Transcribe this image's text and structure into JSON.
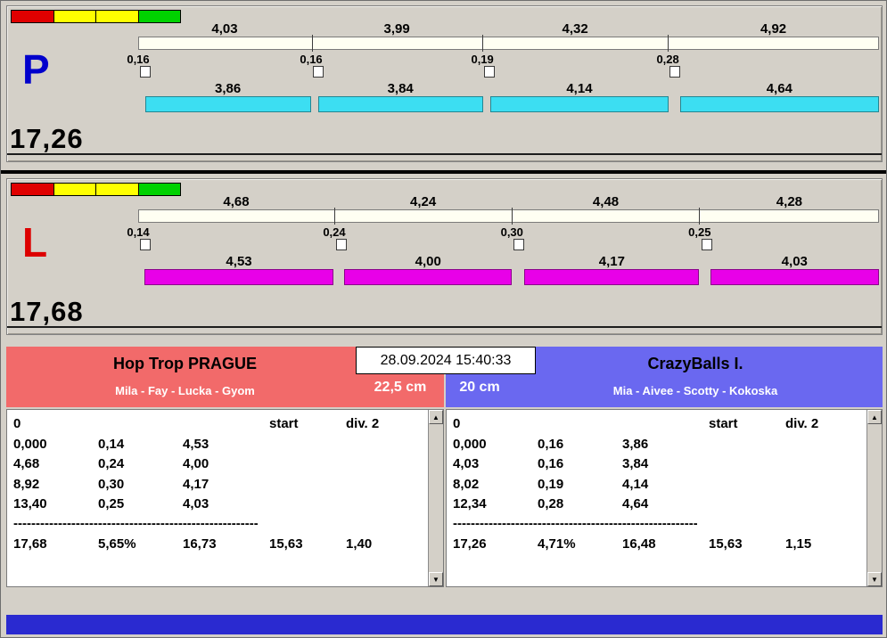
{
  "window": {
    "bg_color": "#d4d0c8",
    "bottom_strip_color": "#2a2ad0"
  },
  "status_lights": {
    "colors": [
      "#e00000",
      "#ffff00",
      "#ffff00",
      "#00d200"
    ]
  },
  "lanes": [
    {
      "label": "P",
      "label_color": "#0000cc",
      "total": "17,26",
      "run_bar_color": "#3cdef2",
      "splits_top": [
        "4,03",
        "3,99",
        "4,32",
        "4,92"
      ],
      "reactions": [
        "0,16",
        "0,16",
        "0,19",
        "0,28"
      ],
      "runs": [
        "3,86",
        "3,84",
        "4,14",
        "4,64"
      ]
    },
    {
      "label": "L",
      "label_color": "#dd0000",
      "total": "17,68",
      "run_bar_color": "#e800e8",
      "splits_top": [
        "4,68",
        "4,24",
        "4,48",
        "4,28"
      ],
      "reactions": [
        "0,14",
        "0,24",
        "0,30",
        "0,25"
      ],
      "runs": [
        "4,53",
        "4,00",
        "4,17",
        "4,03"
      ]
    }
  ],
  "scoreboard": {
    "datetime": "28.09.2024 15:40:33",
    "left_team": {
      "name": "Hop Trop PRAGUE",
      "members": "Mila - Fay - Lucka - Gyom",
      "jump_height": "22,5 cm",
      "header_color": "#f26a6a"
    },
    "right_team": {
      "name": "CrazyBalls I.",
      "members": "Mia - Aivee - Scotty - Kokoska",
      "jump_height": "20 cm",
      "header_color": "#6a68f0"
    }
  },
  "tables": {
    "left": {
      "lap_counter": "0",
      "start_label": "start",
      "division_label": "div. 2",
      "rows": [
        [
          "0,000",
          "0,14",
          "4,53"
        ],
        [
          "4,68",
          "0,24",
          "4,00"
        ],
        [
          "8,92",
          "0,30",
          "4,17"
        ],
        [
          "13,40",
          "0,25",
          "4,03"
        ]
      ],
      "separator": "------------------------------------------------------------",
      "summary": [
        "17,68",
        "5,65%",
        "16,73",
        "15,63",
        "1,40"
      ]
    },
    "right": {
      "lap_counter": "0",
      "start_label": "start",
      "division_label": "div. 2",
      "rows": [
        [
          "0,000",
          "0,16",
          "3,86"
        ],
        [
          "4,03",
          "0,16",
          "3,84"
        ],
        [
          "8,02",
          "0,19",
          "4,14"
        ],
        [
          "12,34",
          "0,28",
          "4,64"
        ]
      ],
      "separator": "------------------------------------------------------------",
      "summary": [
        "17,26",
        "4,71%",
        "16,48",
        "15,63",
        "1,15"
      ]
    }
  },
  "icons": {
    "scroll_up": "▲",
    "scroll_down": "▼"
  }
}
